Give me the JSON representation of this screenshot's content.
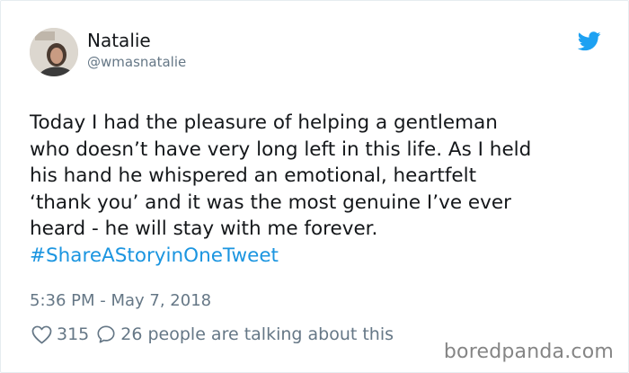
{
  "author": {
    "name": "Natalie",
    "handle": "@wmasnatalie"
  },
  "icons": {
    "platform": "twitter-bird-icon",
    "like": "heart-outline-icon",
    "reply": "speech-bubble-icon"
  },
  "colors": {
    "brand": "#1da1f2",
    "hashtag": "#1b95e0",
    "secondary_text": "#657786"
  },
  "tweet": {
    "lines": [
      "Today I had the pleasure of helping a gentleman",
      "who doesn’t have very long left in this life. As I held",
      "his hand he whispered an emotional, heartfelt",
      "‘thank you’ and it was the most genuine I’ve ever",
      "heard - he will stay with me forever."
    ],
    "hashtag": "#ShareAStoryinOneTweet",
    "timestamp": "5:36 PM - May 7, 2018"
  },
  "engagement": {
    "likes": "315",
    "replies": "26 people are talking about this"
  },
  "watermark": "boredpanda.com"
}
